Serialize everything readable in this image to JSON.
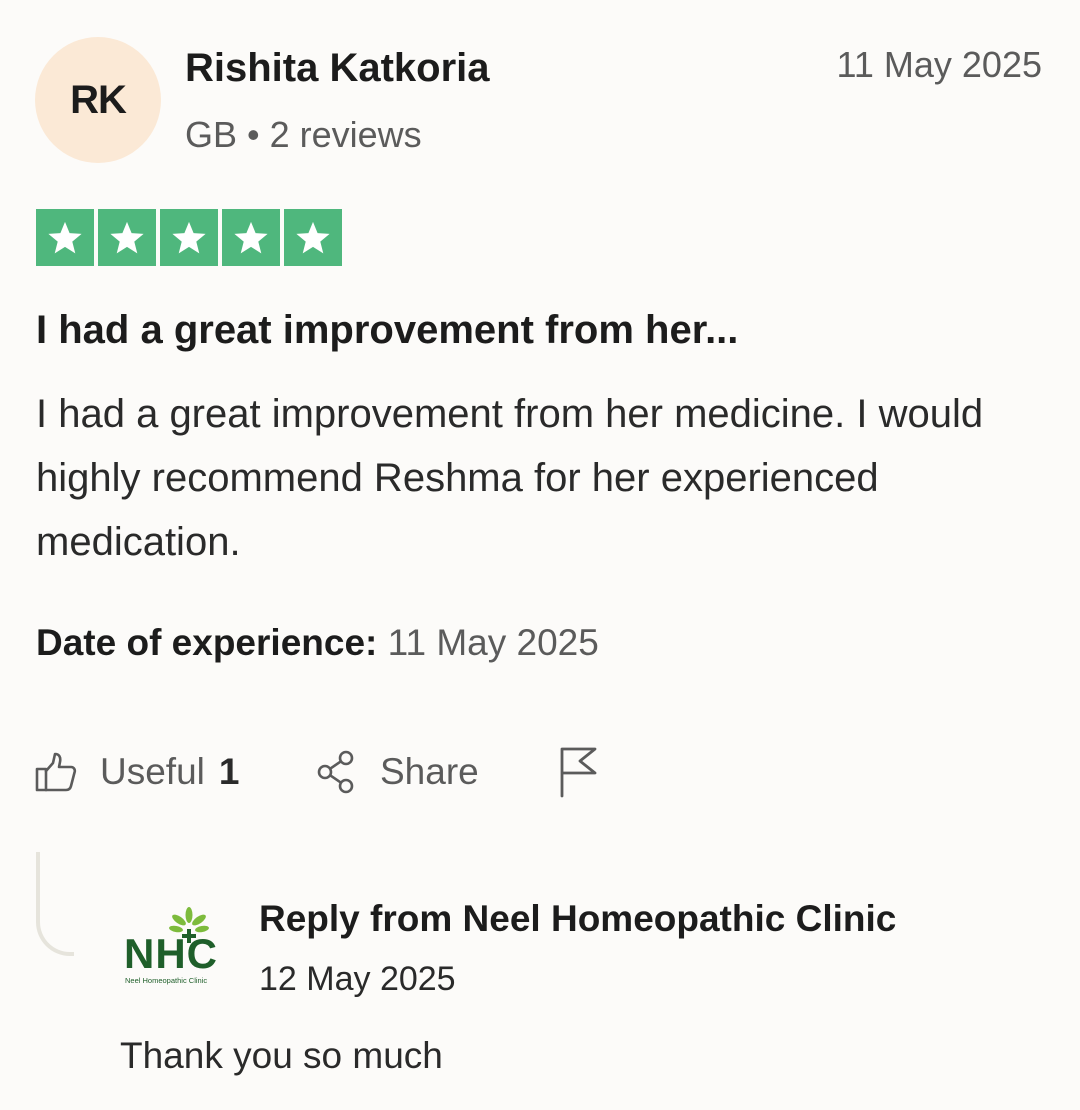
{
  "reviewer": {
    "initials": "RK",
    "name": "Rishita Katkoria",
    "meta": "GB • 2 reviews",
    "avatar_color": "#fbe9d6"
  },
  "review": {
    "date": "11 May 2025",
    "rating": 5,
    "rating_max": 5,
    "star_color": "#4fb77d",
    "title": "I had a great improvement from her...",
    "body": "I had a great improvement from her medicine. I would highly recommend Reshma for her experienced medication.",
    "experience_label": "Date of experience:",
    "experience_date": "11 May 2025"
  },
  "actions": {
    "useful_label": "Useful",
    "useful_count": "1",
    "share_label": "Share",
    "useful_icon": "thumbs-up-icon",
    "share_icon": "share-icon",
    "flag_icon": "flag-icon"
  },
  "reply": {
    "title": "Reply from Neel Homeopathic Clinic",
    "date": "12 May 2025",
    "body": "Thank you so much",
    "logo": {
      "letters": "NHC",
      "caption": "Neel Homeopathic Clinic",
      "color": "#1f5f2a",
      "leaf_color": "#7dbb3c"
    }
  }
}
